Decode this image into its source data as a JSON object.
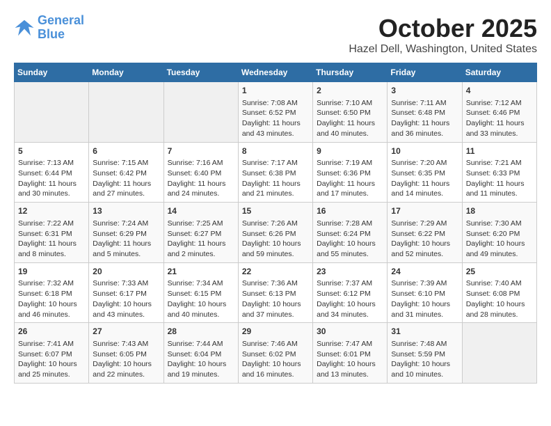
{
  "header": {
    "logo_line1": "General",
    "logo_line2": "Blue",
    "month": "October 2025",
    "location": "Hazel Dell, Washington, United States"
  },
  "weekdays": [
    "Sunday",
    "Monday",
    "Tuesday",
    "Wednesday",
    "Thursday",
    "Friday",
    "Saturday"
  ],
  "weeks": [
    [
      {
        "day": "",
        "empty": true
      },
      {
        "day": "",
        "empty": true
      },
      {
        "day": "",
        "empty": true
      },
      {
        "day": "1",
        "sunrise": "7:08 AM",
        "sunset": "6:52 PM",
        "daylight": "11 hours and 43 minutes."
      },
      {
        "day": "2",
        "sunrise": "7:10 AM",
        "sunset": "6:50 PM",
        "daylight": "11 hours and 40 minutes."
      },
      {
        "day": "3",
        "sunrise": "7:11 AM",
        "sunset": "6:48 PM",
        "daylight": "11 hours and 36 minutes."
      },
      {
        "day": "4",
        "sunrise": "7:12 AM",
        "sunset": "6:46 PM",
        "daylight": "11 hours and 33 minutes."
      }
    ],
    [
      {
        "day": "5",
        "sunrise": "7:13 AM",
        "sunset": "6:44 PM",
        "daylight": "11 hours and 30 minutes."
      },
      {
        "day": "6",
        "sunrise": "7:15 AM",
        "sunset": "6:42 PM",
        "daylight": "11 hours and 27 minutes."
      },
      {
        "day": "7",
        "sunrise": "7:16 AM",
        "sunset": "6:40 PM",
        "daylight": "11 hours and 24 minutes."
      },
      {
        "day": "8",
        "sunrise": "7:17 AM",
        "sunset": "6:38 PM",
        "daylight": "11 hours and 21 minutes."
      },
      {
        "day": "9",
        "sunrise": "7:19 AM",
        "sunset": "6:36 PM",
        "daylight": "11 hours and 17 minutes."
      },
      {
        "day": "10",
        "sunrise": "7:20 AM",
        "sunset": "6:35 PM",
        "daylight": "11 hours and 14 minutes."
      },
      {
        "day": "11",
        "sunrise": "7:21 AM",
        "sunset": "6:33 PM",
        "daylight": "11 hours and 11 minutes."
      }
    ],
    [
      {
        "day": "12",
        "sunrise": "7:22 AM",
        "sunset": "6:31 PM",
        "daylight": "11 hours and 8 minutes."
      },
      {
        "day": "13",
        "sunrise": "7:24 AM",
        "sunset": "6:29 PM",
        "daylight": "11 hours and 5 minutes."
      },
      {
        "day": "14",
        "sunrise": "7:25 AM",
        "sunset": "6:27 PM",
        "daylight": "11 hours and 2 minutes."
      },
      {
        "day": "15",
        "sunrise": "7:26 AM",
        "sunset": "6:26 PM",
        "daylight": "10 hours and 59 minutes."
      },
      {
        "day": "16",
        "sunrise": "7:28 AM",
        "sunset": "6:24 PM",
        "daylight": "10 hours and 55 minutes."
      },
      {
        "day": "17",
        "sunrise": "7:29 AM",
        "sunset": "6:22 PM",
        "daylight": "10 hours and 52 minutes."
      },
      {
        "day": "18",
        "sunrise": "7:30 AM",
        "sunset": "6:20 PM",
        "daylight": "10 hours and 49 minutes."
      }
    ],
    [
      {
        "day": "19",
        "sunrise": "7:32 AM",
        "sunset": "6:18 PM",
        "daylight": "10 hours and 46 minutes."
      },
      {
        "day": "20",
        "sunrise": "7:33 AM",
        "sunset": "6:17 PM",
        "daylight": "10 hours and 43 minutes."
      },
      {
        "day": "21",
        "sunrise": "7:34 AM",
        "sunset": "6:15 PM",
        "daylight": "10 hours and 40 minutes."
      },
      {
        "day": "22",
        "sunrise": "7:36 AM",
        "sunset": "6:13 PM",
        "daylight": "10 hours and 37 minutes."
      },
      {
        "day": "23",
        "sunrise": "7:37 AM",
        "sunset": "6:12 PM",
        "daylight": "10 hours and 34 minutes."
      },
      {
        "day": "24",
        "sunrise": "7:39 AM",
        "sunset": "6:10 PM",
        "daylight": "10 hours and 31 minutes."
      },
      {
        "day": "25",
        "sunrise": "7:40 AM",
        "sunset": "6:08 PM",
        "daylight": "10 hours and 28 minutes."
      }
    ],
    [
      {
        "day": "26",
        "sunrise": "7:41 AM",
        "sunset": "6:07 PM",
        "daylight": "10 hours and 25 minutes."
      },
      {
        "day": "27",
        "sunrise": "7:43 AM",
        "sunset": "6:05 PM",
        "daylight": "10 hours and 22 minutes."
      },
      {
        "day": "28",
        "sunrise": "7:44 AM",
        "sunset": "6:04 PM",
        "daylight": "10 hours and 19 minutes."
      },
      {
        "day": "29",
        "sunrise": "7:46 AM",
        "sunset": "6:02 PM",
        "daylight": "10 hours and 16 minutes."
      },
      {
        "day": "30",
        "sunrise": "7:47 AM",
        "sunset": "6:01 PM",
        "daylight": "10 hours and 13 minutes."
      },
      {
        "day": "31",
        "sunrise": "7:48 AM",
        "sunset": "5:59 PM",
        "daylight": "10 hours and 10 minutes."
      },
      {
        "day": "",
        "empty": true
      }
    ]
  ],
  "labels": {
    "sunrise": "Sunrise:",
    "sunset": "Sunset:",
    "daylight": "Daylight:"
  }
}
